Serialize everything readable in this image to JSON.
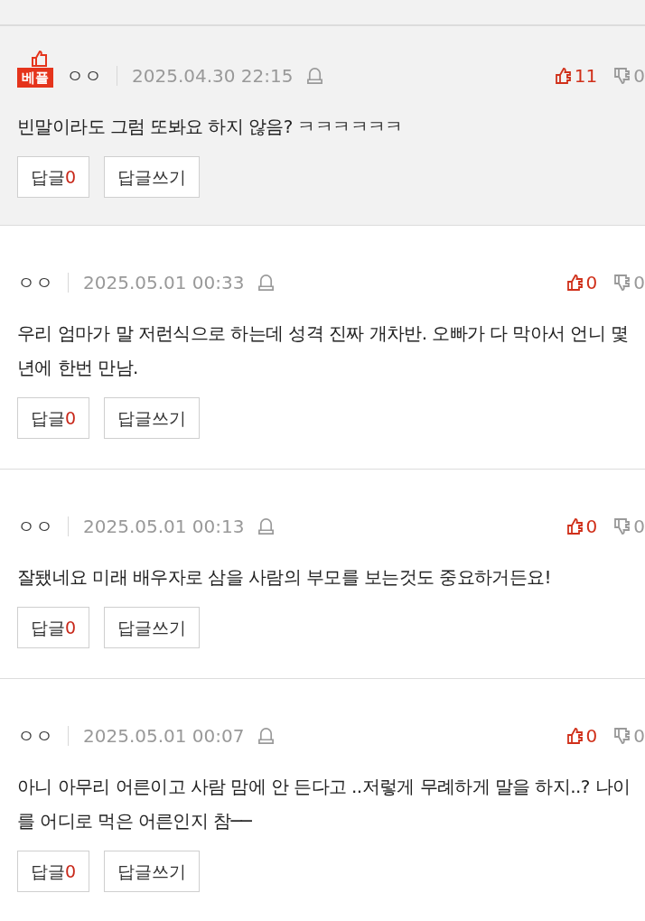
{
  "comments": [
    {
      "best": true,
      "badge": "베플",
      "author": "ㅇㅇ",
      "date": "2025.04.30 22:15",
      "likes": "11",
      "dislikes": "0",
      "text": "빈말이라도 그럼 또봐요 하지 않음? ㅋㅋㅋㅋㅋㅋ",
      "reply_label": "답글",
      "reply_count": "0",
      "write_label": "답글쓰기"
    },
    {
      "best": false,
      "author": "ㅇㅇ",
      "date": "2025.05.01 00:33",
      "likes": "0",
      "dislikes": "0",
      "text": "우리 엄마가 말 저런식으로 하는데 성격 진짜 개차반. 오빠가 다 막아서 언니 몇년에 한번 만남.",
      "reply_label": "답글",
      "reply_count": "0",
      "write_label": "답글쓰기"
    },
    {
      "best": false,
      "author": "ㅇㅇ",
      "date": "2025.05.01 00:13",
      "likes": "0",
      "dislikes": "0",
      "text": "잘됐네요 미래 배우자로 삼을 사람의 부모를 보는것도 중요하거든요!",
      "reply_label": "답글",
      "reply_count": "0",
      "write_label": "답글쓰기"
    },
    {
      "best": false,
      "author": "ㅇㅇ",
      "date": "2025.05.01 00:07",
      "likes": "0",
      "dislikes": "0",
      "text": "아니 아무리 어른이고 사람 맘에 안 든다고 ..저렇게 무례하게 말을 하지..? 나이를 어디로 먹은 어른인지 참──",
      "reply_label": "답글",
      "reply_count": "0",
      "write_label": "답글쓰기"
    }
  ]
}
